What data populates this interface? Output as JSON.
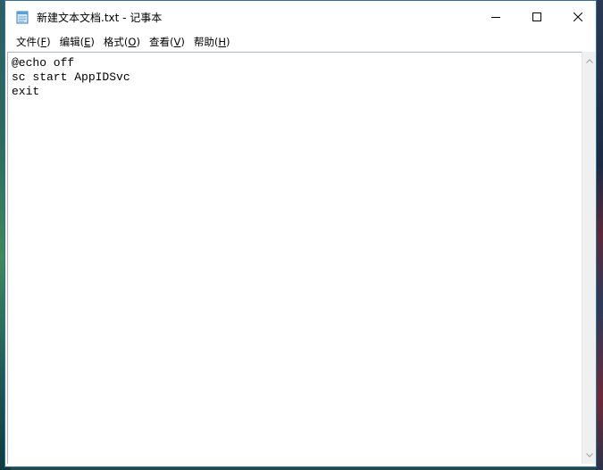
{
  "window": {
    "title": "新建文本文档.txt - 记事本",
    "minimize_icon": "minimize-icon",
    "maximize_icon": "maximize-icon",
    "close_icon": "close-icon"
  },
  "menu": [
    {
      "label": "文件(",
      "key": "F",
      "suffix": ")"
    },
    {
      "label": "编辑(",
      "key": "E",
      "suffix": ")"
    },
    {
      "label": "格式(",
      "key": "O",
      "suffix": ")"
    },
    {
      "label": "查看(",
      "key": "V",
      "suffix": ")"
    },
    {
      "label": "帮助(",
      "key": "H",
      "suffix": ")"
    }
  ],
  "editor": {
    "lines": [
      "@echo off",
      "sc start AppIDSvc",
      "exit"
    ]
  },
  "colors": {
    "window_border": "#3a6d9a",
    "scrollbar_bg": "#f0f0f0"
  }
}
